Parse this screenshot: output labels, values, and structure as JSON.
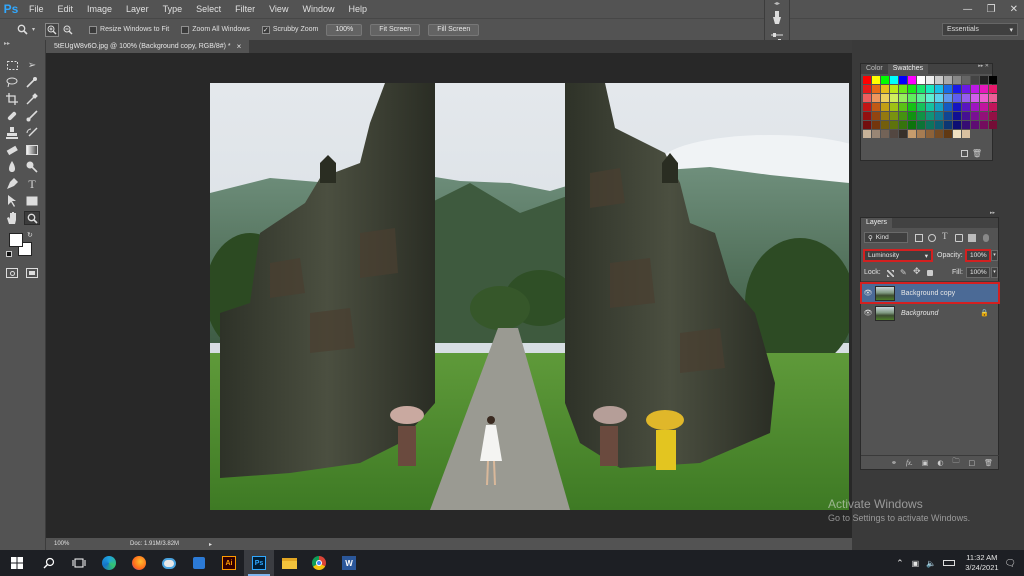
{
  "app": {
    "logo": "Ps"
  },
  "menu": [
    "File",
    "Edit",
    "Image",
    "Layer",
    "Type",
    "Select",
    "Filter",
    "View",
    "Window",
    "Help"
  ],
  "options_bar": {
    "resize_windows": "Resize Windows to Fit",
    "zoom_all": "Zoom All Windows",
    "scrubby_zoom": "Scrubby Zoom",
    "btn_100": "100%",
    "btn_fit": "Fit Screen",
    "btn_fill": "Fill Screen",
    "workspace": "Essentials"
  },
  "document": {
    "tab_title": "5tEUgW8v6O.jpg @ 100% (Background copy, RGB/8#) *",
    "close": "×"
  },
  "status": {
    "zoom": "100%",
    "doc": "Doc: 1.91M/3.82M"
  },
  "swatches_panel": {
    "tabs": [
      "Color",
      "Swatches"
    ],
    "active_tab": "Swatches"
  },
  "layers_panel": {
    "title": "Layers",
    "kind_filter": "Kind",
    "blend_mode": "Luminosity",
    "opacity_label": "Opacity:",
    "opacity_value": "100%",
    "lock_label": "Lock:",
    "fill_label": "Fill:",
    "fill_value": "100%",
    "layers": [
      {
        "name": "Background copy",
        "selected": true
      },
      {
        "name": "Background",
        "selected": false
      }
    ],
    "footer_fx": "fx."
  },
  "watermark": {
    "line1": "Activate Windows",
    "line2": "Go to Settings to activate Windows."
  },
  "taskbar": {
    "time": "11:32 AM",
    "date": "3/24/2021"
  },
  "colors": {
    "accent": "#31a8ff",
    "highlight_red": "#d32020",
    "selected_layer": "#4b6a96"
  }
}
